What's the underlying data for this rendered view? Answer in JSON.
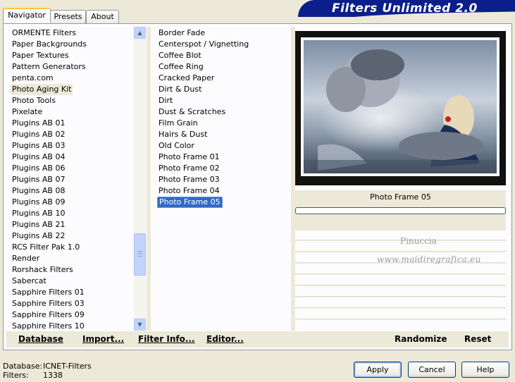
{
  "banner": {
    "title": "Filters Unlimited 2.0"
  },
  "tabs": [
    {
      "label": "Navigator",
      "active": true
    },
    {
      "label": "Presets",
      "active": false
    },
    {
      "label": "About",
      "active": false
    }
  ],
  "categories": {
    "items": [
      "ORMENTE Filters",
      "Paper Backgrounds",
      "Paper Textures",
      "Pattern Generators",
      "penta.com",
      "Photo Aging Kit",
      "Photo Tools",
      "Pixelate",
      "Plugins AB 01",
      "Plugins AB 02",
      "Plugins AB 03",
      "Plugins AB 04",
      "Plugins AB 06",
      "Plugins AB 07",
      "Plugins AB 08",
      "Plugins AB 09",
      "Plugins AB 10",
      "Plugins AB 21",
      "Plugins AB 22",
      "RCS Filter Pak 1.0",
      "Render",
      "Rorshack Filters",
      "Sabercat",
      "Sapphire Filters 01",
      "Sapphire Filters 03",
      "Sapphire Filters 09",
      "Sapphire Filters 10"
    ],
    "selected": "Photo Aging Kit"
  },
  "filters": {
    "items": [
      "Border Fade",
      "Centerspot / Vignetting",
      "Coffee Blot",
      "Coffee Ring",
      "Cracked Paper",
      "Dirt & Dust",
      "Dirt",
      "Dust & Scratches",
      "Film Grain",
      "Hairs & Dust",
      "Old Color",
      "Photo Frame 01",
      "Photo Frame 02",
      "Photo Frame 03",
      "Photo Frame 04",
      "Photo Frame 05"
    ],
    "selected": "Photo Frame 05"
  },
  "preview": {
    "filter_name": "Photo Frame 05"
  },
  "watermark": {
    "line1": "Pinuccia",
    "line2": "www.maidiregrafica.eu"
  },
  "action_bar": {
    "database": "Database",
    "import": "Import...",
    "filter_info": "Filter Info...",
    "editor": "Editor...",
    "randomize": "Randomize",
    "reset": "Reset"
  },
  "footer": {
    "database_label": "Database:",
    "database_value": "ICNET-Filters",
    "filters_label": "Filters:",
    "filters_value": "1338"
  },
  "buttons": {
    "apply": "Apply",
    "cancel": "Cancel",
    "help": "Help"
  },
  "colors": {
    "selection": "#316ac5",
    "banner": "#0b1e8c",
    "dialog_bg": "#ece9d8"
  }
}
